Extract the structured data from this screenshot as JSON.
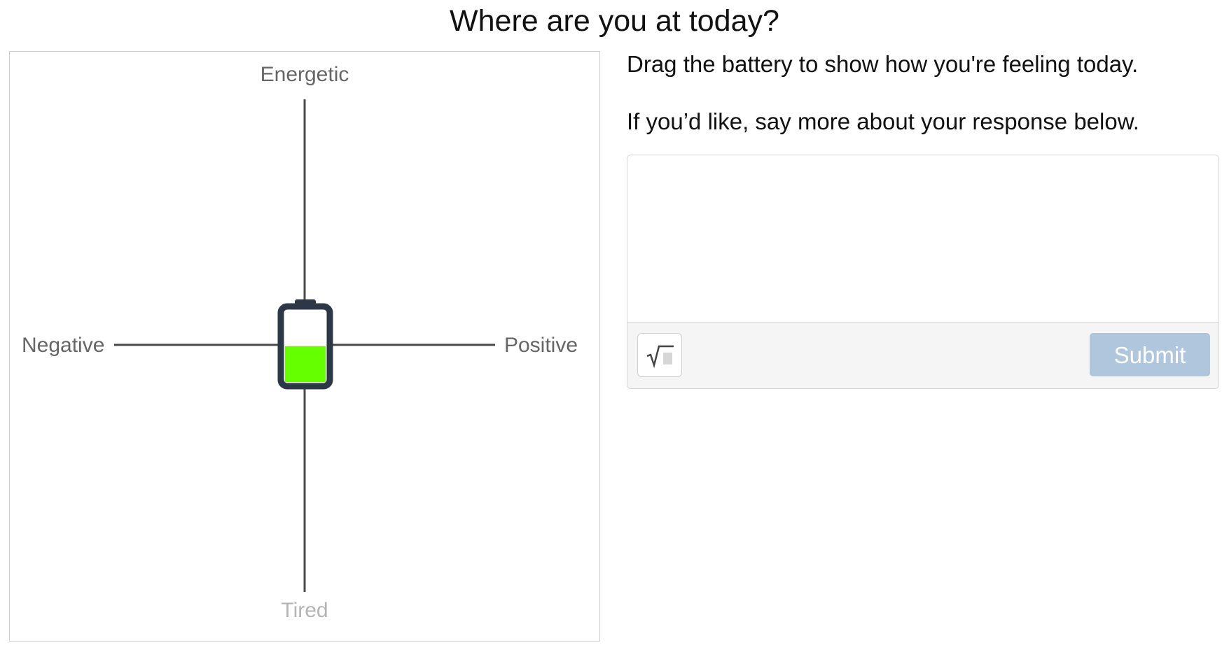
{
  "page": {
    "title": "Where are you at today?"
  },
  "graph": {
    "axes": {
      "top": "Energetic",
      "bottom": "Tired",
      "left": "Negative",
      "right": "Positive"
    },
    "battery": {
      "x": 0,
      "y": 0,
      "charge_level": 0.5,
      "fill_color": "#66ff00",
      "frame_color": "#2d3847"
    },
    "colors": {
      "axis_line": "#4a4a4a",
      "label": "#666666",
      "label_muted": "#b5b5b5"
    }
  },
  "instructions": {
    "drag_prompt": "Drag the battery to show how you're feeling today.",
    "elaborate_prompt": "If you’d like, say more about your response below."
  },
  "response": {
    "value": "",
    "placeholder": "",
    "math_icon": "square-root-icon",
    "submit_label": "Submit",
    "submit_color": "#afc6dd"
  }
}
